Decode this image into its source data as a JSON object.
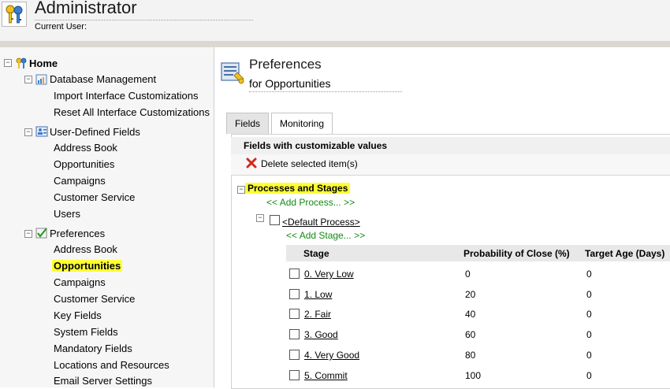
{
  "header": {
    "title": "Administrator",
    "current_user_label": "Current User:"
  },
  "sidebar": {
    "home": "Home",
    "database_management": {
      "label": "Database Management",
      "items": [
        "Import Interface Customizations",
        "Reset All Interface Customizations"
      ]
    },
    "user_defined_fields": {
      "label": "User-Defined Fields",
      "items": [
        "Address Book",
        "Opportunities",
        "Campaigns",
        "Customer Service",
        "Users"
      ]
    },
    "preferences": {
      "label": "Preferences",
      "items": [
        "Address Book",
        "Opportunities",
        "Campaigns",
        "Customer Service",
        "Key Fields",
        "System Fields",
        "Mandatory Fields",
        "Locations and Resources",
        "Email Server Settings"
      ],
      "selected": "Opportunities"
    },
    "toggle_symbol": "−"
  },
  "main": {
    "title": "Preferences",
    "subtitle": "for Opportunities",
    "tabs": [
      {
        "label": "Fields",
        "active": false
      },
      {
        "label": "Monitoring",
        "active": true
      }
    ],
    "panel_title": "Fields with customizable values",
    "delete_label": "Delete selected item(s)",
    "processes_label": "Processes and Stages",
    "add_process": "<< Add Process... >>",
    "default_process": "<Default Process>",
    "add_stage": "<< Add Stage... >>",
    "table": {
      "columns": [
        "Stage",
        "Probability of Close (%)",
        "Target Age (Days)"
      ],
      "rows": [
        {
          "stage": "0. Very Low",
          "probability": "0",
          "target_age": "0"
        },
        {
          "stage": "1. Low",
          "probability": "20",
          "target_age": "0"
        },
        {
          "stage": "2. Fair",
          "probability": "40",
          "target_age": "0"
        },
        {
          "stage": "3. Good",
          "probability": "60",
          "target_age": "0"
        },
        {
          "stage": "4. Very Good",
          "probability": "80",
          "target_age": "0"
        },
        {
          "stage": "5. Commit",
          "probability": "100",
          "target_age": "0"
        }
      ]
    }
  },
  "colors": {
    "highlight": "#ffff33",
    "link_green": "#138a13",
    "delete_red": "#d22a1e"
  },
  "icons": {
    "logo": "keys-icon",
    "home": "home-keys-icon",
    "database": "database-icon",
    "user_fields": "user-fields-icon",
    "preferences": "checkmark-icon",
    "preferences_page": "preferences-page-icon",
    "delete": "red-x-icon"
  }
}
